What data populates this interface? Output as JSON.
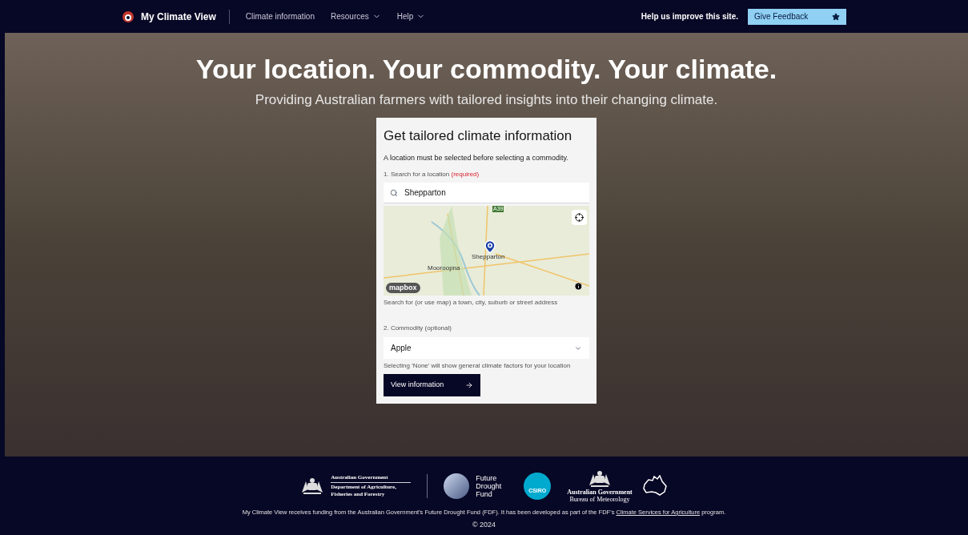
{
  "header": {
    "brand": "My Climate View",
    "nav": [
      {
        "label": "Climate information",
        "has_menu": false
      },
      {
        "label": "Resources",
        "has_menu": true
      },
      {
        "label": "Help",
        "has_menu": true
      }
    ],
    "prompt": "Help us improve this site.",
    "feedback_button": "Give Feedback"
  },
  "hero": {
    "title": "Your location. Your commodity. Your climate.",
    "subtitle": "Providing Australian farmers with tailored insights into their changing climate."
  },
  "form": {
    "title": "Get tailored climate information",
    "note": "A location must be selected before selecting a commodity.",
    "location_label": "1. Search for a location",
    "location_required": "(required)",
    "location_value": "Shepparton",
    "map": {
      "labels": [
        {
          "text": "A39",
          "kind": "road"
        },
        {
          "text": "Shepparton",
          "kind": "town"
        },
        {
          "text": "Mooroopna",
          "kind": "town"
        }
      ],
      "attribution": "mapbox"
    },
    "location_help": "Search for (or use map) a town, city, suburb or street address",
    "commodity_label": "2. Commodity (optional)",
    "commodity_value": "Apple",
    "commodity_help": "Selecting 'None' will show general climate factors for your location",
    "submit": "View information"
  },
  "footer": {
    "logos": [
      {
        "kind": "gov",
        "lines": [
          "Australian Government",
          "Department of Agriculture, Fisheries and Forestry"
        ]
      },
      {
        "kind": "fdf",
        "lines": [
          "Future",
          "Drought",
          "Fund"
        ]
      },
      {
        "kind": "csiro",
        "lines": [
          "CSIRO"
        ]
      },
      {
        "kind": "bom",
        "lines": [
          "Australian Government",
          "Bureau of Meteorology"
        ]
      }
    ],
    "funding": {
      "before": "My Climate View receives funding from the Australian Government's Future Drought Fund (FDF). It has been developed as part of the FDF's",
      "link": "Climate Services for Agriculture",
      "after": "program."
    },
    "copyright": "© 2024"
  }
}
